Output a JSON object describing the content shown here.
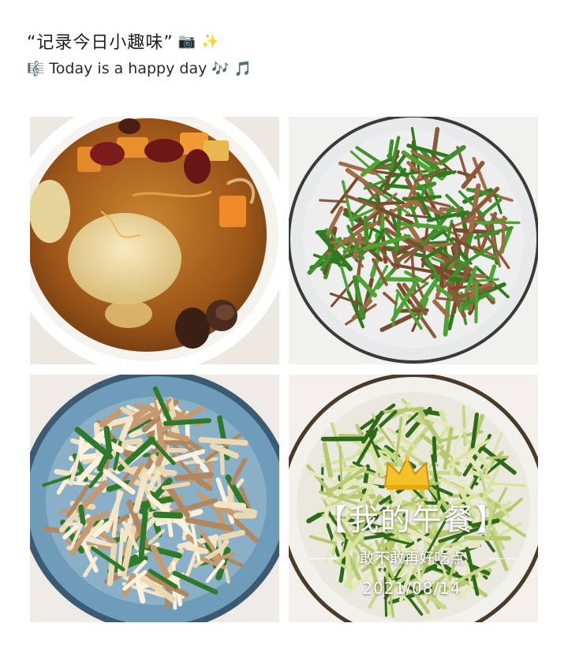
{
  "header": {
    "title": "“记录今日小趣味”",
    "title_icons": [
      "camera-icon",
      "sparkles-icon"
    ],
    "subtitle": "Today is a happy day",
    "subtitle_icons": [
      "music-score-icon",
      "music-notes-icon",
      "music-note-icon"
    ]
  },
  "photos": [
    {
      "subject": "chicken-soup"
    },
    {
      "subject": "stir-fried-pork-green-pepper"
    },
    {
      "subject": "mushroom-pork-stir-fry"
    },
    {
      "subject": "cucumber-salad"
    }
  ],
  "overlay": {
    "title": "【我的午餐】",
    "subtitle": "敢不敢再好吃点",
    "date": "2021/08/14",
    "icon": "crown-icon"
  },
  "colors": {
    "soup": "#a8601e",
    "pepper": "#3f8f2a",
    "plate_blue": "#6f9cb9",
    "crown": "#f3c12a"
  }
}
